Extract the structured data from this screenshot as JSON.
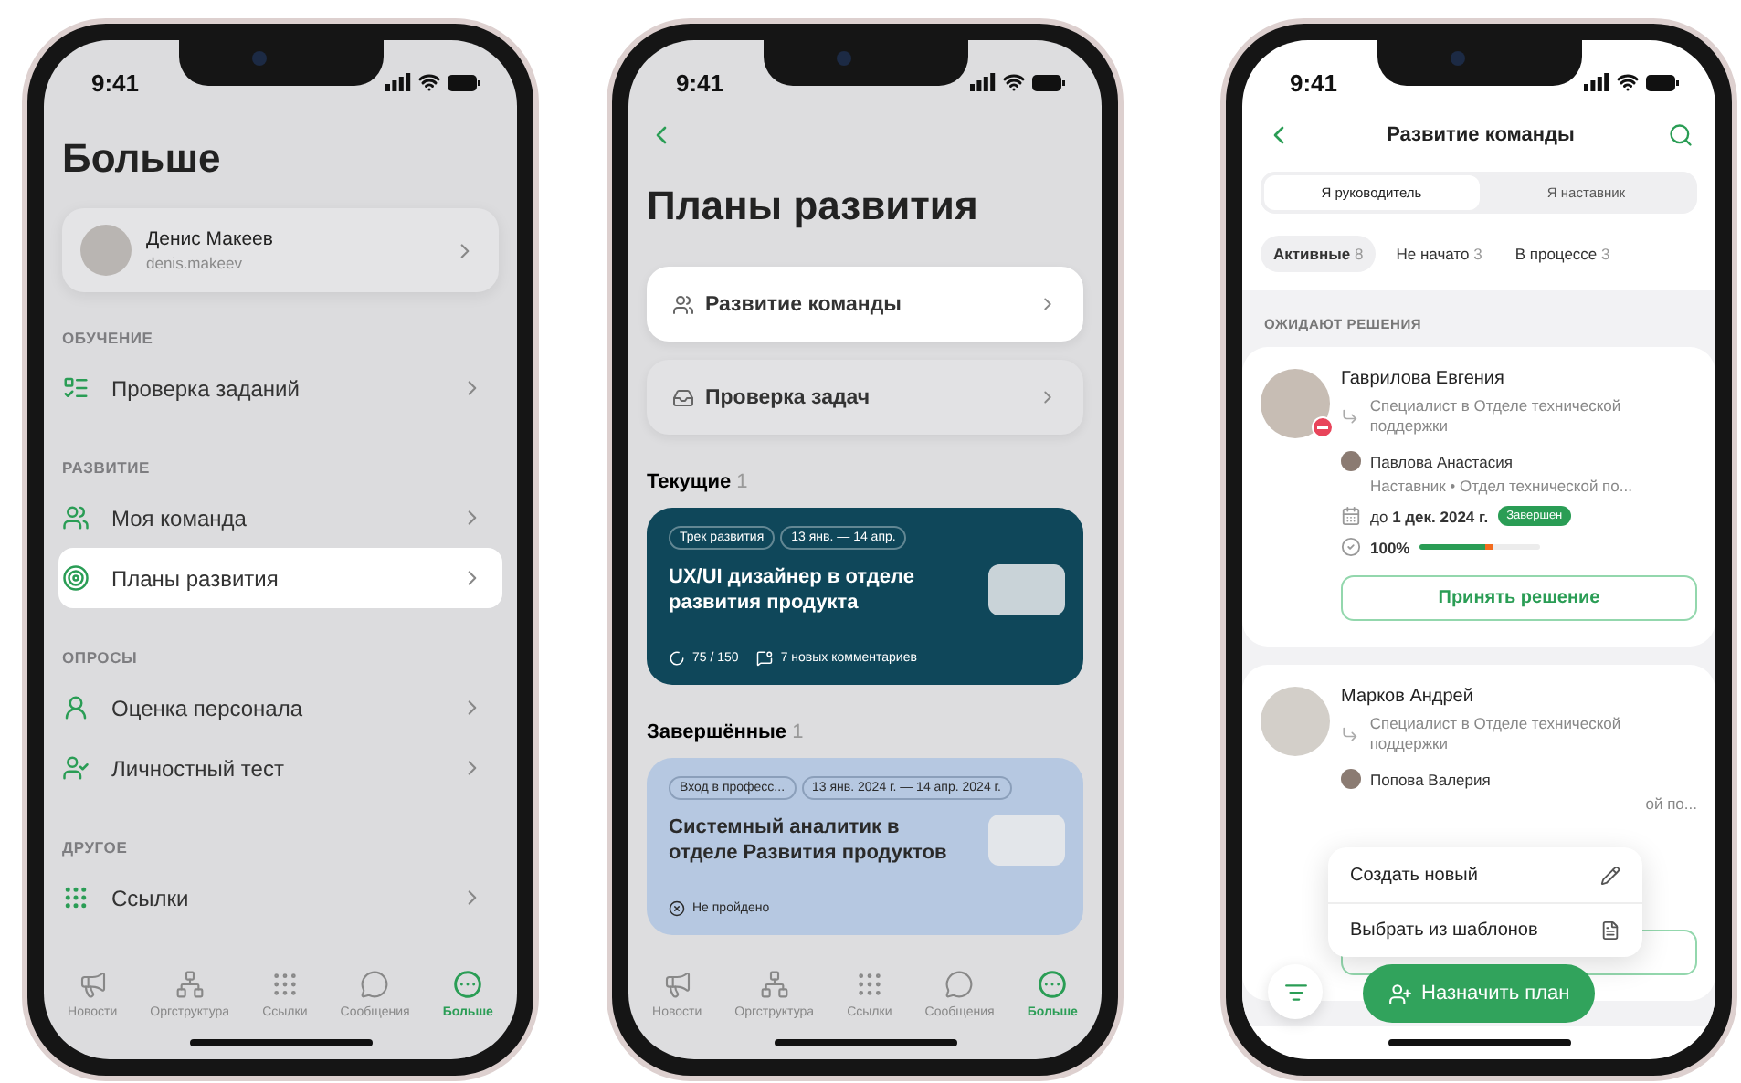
{
  "phones": [
    {
      "kind": "more",
      "time": "9:41",
      "title": "Больше",
      "profile": {
        "name": "Денис Макеев",
        "login": "denis.makeev"
      },
      "sections": [
        {
          "heading": "ОБУЧЕНИЕ",
          "items": [
            {
              "label": "Проверка заданий",
              "selected": false
            }
          ]
        },
        {
          "heading": "РАЗВИТИЕ",
          "items": [
            {
              "label": "Моя команда",
              "selected": false
            },
            {
              "label": "Планы развития",
              "selected": true
            }
          ]
        },
        {
          "heading": "ОПРОСЫ",
          "items": [
            {
              "label": "Оценка персонала",
              "selected": false
            },
            {
              "label": "Личностный тест",
              "selected": false
            }
          ]
        },
        {
          "heading": "ДРУГОЕ",
          "items": [
            {
              "label": "Ссылки",
              "selected": false
            }
          ]
        }
      ],
      "tab_bar": [
        {
          "label": "Новости",
          "selected": false
        },
        {
          "label": "Оргструктура",
          "selected": false
        },
        {
          "label": "Ссылки",
          "selected": false
        },
        {
          "label": "Сообщения",
          "selected": false
        },
        {
          "label": "Больше",
          "selected": true
        }
      ]
    },
    {
      "kind": "plans",
      "time": "9:41",
      "title": "Планы развития",
      "links": [
        {
          "label": "Развитие команды",
          "selected": true
        },
        {
          "label": "Проверка задач",
          "selected": false
        }
      ],
      "groups": [
        {
          "heading": "Текущие",
          "count": "1",
          "cards": [
            {
              "kind": "current",
              "tags": [
                "Трек развития",
                "13 янв. — 14 апр."
              ],
              "title": "UX/UI дизайнер в отделе развития продукта",
              "progress": "75 / 150",
              "comments": "7 новых комментариев"
            }
          ]
        },
        {
          "heading": "Завершённые",
          "count": "1",
          "cards": [
            {
              "kind": "completed",
              "tags": [
                "Вход в професс...",
                "13 янв. 2024 г. — 14 апр. 2024 г."
              ],
              "title": "Системный аналитик в отделе Развития продуктов",
              "status": "Не пройдено"
            }
          ]
        }
      ],
      "tab_bar": [
        {
          "label": "Новости",
          "selected": false
        },
        {
          "label": "Оргструктура",
          "selected": false
        },
        {
          "label": "Ссылки",
          "selected": false
        },
        {
          "label": "Сообщения",
          "selected": false
        },
        {
          "label": "Больше",
          "selected": true
        }
      ]
    },
    {
      "kind": "team",
      "time": "9:41",
      "title": "Развитие команды",
      "segments": [
        {
          "label": "Я руководитель",
          "selected": true
        },
        {
          "label": "Я наставник",
          "selected": false
        }
      ],
      "filters": [
        {
          "label": "Активные",
          "count": "8",
          "selected": true
        },
        {
          "label": "Не начато",
          "count": "3",
          "selected": false
        },
        {
          "label": "В процессе",
          "count": "3",
          "selected": false
        }
      ],
      "section": "ОЖИДАЮТ РЕШЕНИЯ",
      "people": [
        {
          "name": "Гаврилова Евгения",
          "blocked": true,
          "position": "Специалист в Отделе технической поддержки",
          "mentor": {
            "name": "Павлова Анастасия",
            "role": "Наставник • Отдел технической по..."
          },
          "deadline": "до **1 дек. 2024 г.**",
          "badge": "Завершен",
          "percent": "100%",
          "level": 0.55,
          "action": "Принять решение"
        },
        {
          "name": "Марков Андрей",
          "blocked": false,
          "position": "Специалист в Отделе технической поддержки",
          "mentor": {
            "name": "Попова Валерия",
            "role_tail": "ой по..."
          }
        }
      ],
      "menu": [
        "Создать новый",
        "Выбрать из шаблонов"
      ],
      "fab": "Назначить план"
    }
  ]
}
